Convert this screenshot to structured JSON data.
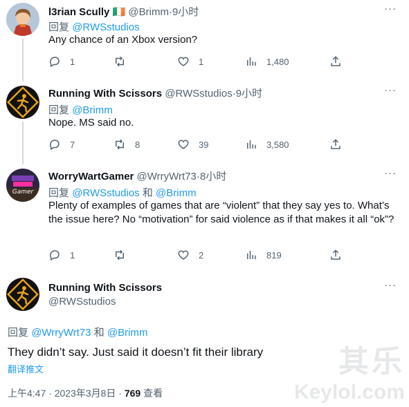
{
  "tweets": [
    {
      "name": "l3rian Scully",
      "flag": "🇮🇪",
      "handle": "@Brimm",
      "time": "9小时",
      "reply_prefix": "回复",
      "reply_to": "@RWSstudios",
      "text": "Any chance of an Xbox version?",
      "replies": "1",
      "retweets": "",
      "likes": "1",
      "views": "1,480"
    },
    {
      "name": "Running With Scissors",
      "handle": "@RWSstudios",
      "time": "9小时",
      "reply_prefix": "回复",
      "reply_to": "@Brimm",
      "text": "Nope. MS said no.",
      "replies": "7",
      "retweets": "8",
      "likes": "39",
      "views": "3,580"
    },
    {
      "name": "WorryWartGamer",
      "handle": "@WrryWrt73",
      "time": "8小时",
      "reply_prefix": "回复",
      "reply_to": "@RWSstudios",
      "and_word": "和",
      "reply_to2": "@Brimm",
      "text": "Plenty of examples of games that are “violent” that they say yes to. What’s the issue here? No “motivation” for said violence as if that makes it all “ok”?",
      "replies": "1",
      "retweets": "",
      "likes": "2",
      "views": "819"
    }
  ],
  "main_tweet": {
    "name": "Running With Scissors",
    "handle": "@RWSstudios",
    "reply_prefix": "回复",
    "reply_to": "@WrryWrt73",
    "and_word": "和",
    "reply_to2": "@Brimm",
    "text": "They didn’t say. Just said it doesn’t fit their library",
    "translate_label": "翻译推文",
    "timestamp": "上午4:47 · 2023年3月8日 ·",
    "views_count": "769",
    "views_label": "查看"
  },
  "more_label": "···",
  "sep": "·",
  "watermark": {
    "line1": "其乐",
    "line2": "Keylol.com"
  },
  "colors": {
    "link": "#1d9bf0",
    "muted": "#536471",
    "text": "#0f1419",
    "line": "#cfd9de"
  }
}
